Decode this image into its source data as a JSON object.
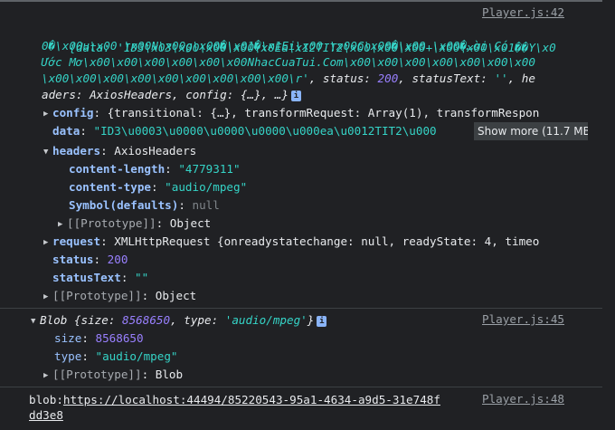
{
  "log1": {
    "source": "Player.js:42",
    "summary_lines": [
      "{data: 'ID3\\x03\\x00\\x00\\x00\\x0Ea\\x12TIT2\\x00\\x00\\x00+\\x00\\x00\\x01��Y\\x0",
      "0�\\x00u\\x00 \\x00N\\x00g\\x00�\\x01�\\x1Ei\\x00 \\x00C\\x00�\\x00 \\x00�…ời Có",
      "Ước Mơ\\x00\\x00\\x00\\x00\\x00\\x00NhacCuaTui.Com\\x00\\x00\\x00\\x00\\x00\\x00\\x00"
    ],
    "summary_line4_pre": "\\x00\\x00\\x00\\x00\\x00\\x00\\x00\\x00\\x00\\r'",
    "summary_line4_status_key": ", status: ",
    "summary_line4_status_val": "200",
    "summary_line4_text_key": ", statusText: ",
    "summary_line4_text_val": "''",
    "summary_line4_tail": ", he",
    "summary_line5": "aders: AxiosHeaders, config: {…}, …}",
    "info_icon": "i",
    "config_key": "config",
    "config_value": "{transitional: {…}, transformRequest: Array(1), transformRespon",
    "data_key": "data",
    "data_value": "\"ID3\\u0003\\u0000\\u0000\\u0000\\u000ea\\u0012TIT2\\u000",
    "show_more": "Show more (11.7 MB)",
    "headers_key": "headers",
    "headers_type": "AxiosHeaders",
    "content_length_key": "content-length",
    "content_length_val": "\"4779311\"",
    "content_type_key": "content-type",
    "content_type_val": "\"audio/mpeg\"",
    "symbol_key": "Symbol(defaults)",
    "symbol_val": "null",
    "proto_inner_key": "[[Prototype]]",
    "proto_inner_val": "Object",
    "request_key": "request",
    "request_value": "XMLHttpRequest {onreadystatechange: null, readyState: 4, timeo",
    "status_key": "status",
    "status_val": "200",
    "statustext_key": "statusText",
    "statustext_val": "\"\"",
    "proto_key": "[[Prototype]]",
    "proto_val": "Object"
  },
  "log2": {
    "source": "Player.js:45",
    "label": "Blob",
    "summary_open": " {size: ",
    "summary_size": "8568650",
    "summary_mid": ", type: ",
    "summary_type": "'audio/mpeg'",
    "summary_close": "}",
    "size_key": "size",
    "size_val": "8568650",
    "type_key": "type",
    "type_val": "\"audio/mpeg\"",
    "proto_key": "[[Prototype]]",
    "proto_val": "Blob"
  },
  "log3": {
    "source": "Player.js:48",
    "prefix": "blob:",
    "url_part1": "https://localhost:44494/85220543-95a1-4634-a9d5-31e748f",
    "url_part2": "dd3e8"
  },
  "colors": {
    "background": "#202124",
    "key": "#9ac2ff",
    "string": "#35d4c7",
    "number": "#9980ff",
    "null": "#80868b"
  }
}
